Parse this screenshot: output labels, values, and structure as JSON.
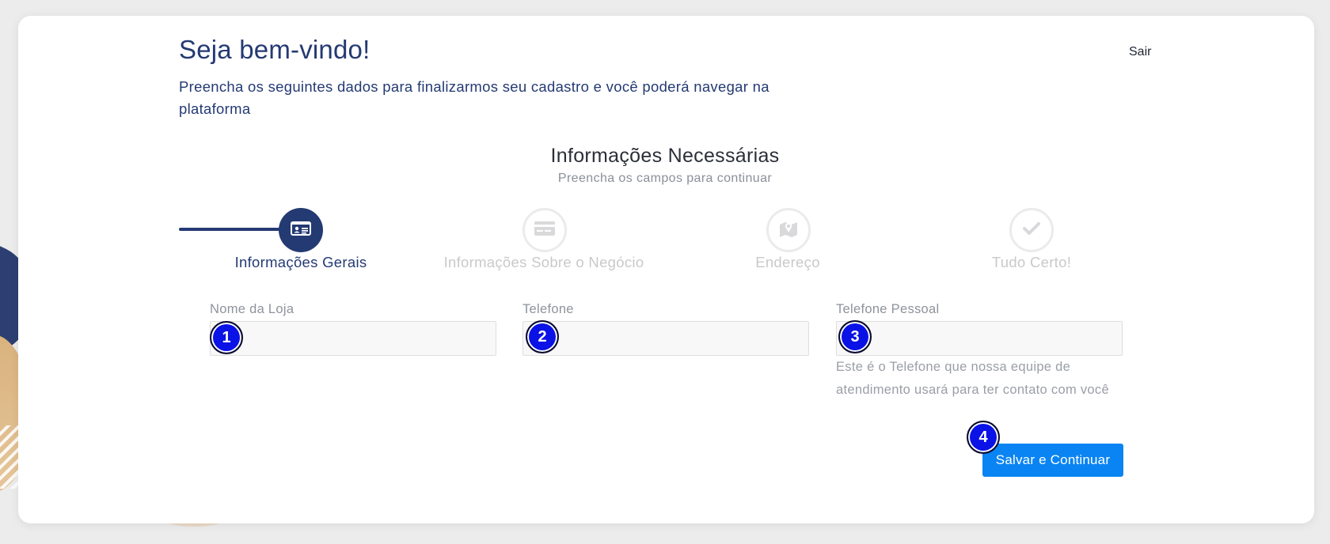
{
  "header": {
    "title": "Seja bem-vindo!",
    "subtitle": "Preencha os seguintes dados para finalizarmos seu cadastro e você poderá navegar na plataforma",
    "logout_label": "Sair"
  },
  "section": {
    "title": "Informações Necessárias",
    "subtitle": "Preencha os campos para continuar"
  },
  "steps": [
    {
      "label": "Informações Gerais",
      "icon": "id-card-icon",
      "state": "active"
    },
    {
      "label": "Informações Sobre o Negócio",
      "icon": "credit-card-icon",
      "state": "inactive"
    },
    {
      "label": "Endereço",
      "icon": "map-icon",
      "state": "inactive"
    },
    {
      "label": "Tudo Certo!",
      "icon": "check-icon",
      "state": "inactive"
    }
  ],
  "form": {
    "store_name": {
      "label": "Nome da Loja",
      "value": "",
      "placeholder": ""
    },
    "phone": {
      "label": "Telefone",
      "value": "",
      "placeholder": ""
    },
    "personal_phone": {
      "label": "Telefone Pessoal",
      "value": "",
      "placeholder": "",
      "help": "Este é o Telefone que nossa equipe de atendimento usará para ter contato com você"
    }
  },
  "actions": {
    "save_label": "Salvar e Continuar"
  },
  "markers": [
    "1",
    "2",
    "3",
    "4"
  ],
  "colors": {
    "primary": "#243a73",
    "button": "#0a84f3",
    "marker": "#0a12e6",
    "inactive": "#c9c9cc"
  }
}
